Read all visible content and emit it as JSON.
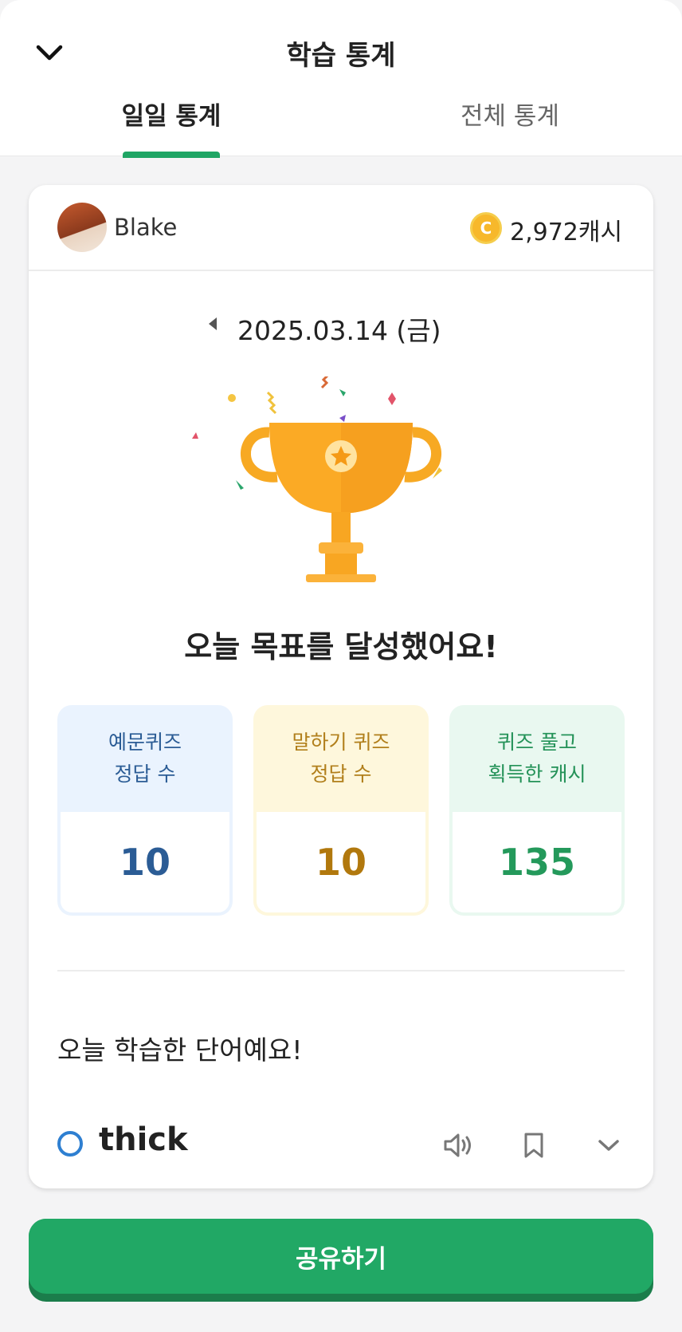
{
  "header": {
    "title": "학습 통계",
    "back_icon": "chevron-down-icon"
  },
  "tabs": [
    {
      "label": "일일 통계",
      "active": true
    },
    {
      "label": "전체 통계",
      "active": false
    }
  ],
  "profile": {
    "name": "Blake",
    "cash": "2,972캐시",
    "coin_symbol": "C"
  },
  "date": {
    "text": "2025.03.14 (금)"
  },
  "goal_message": "오늘 목표를 달성했어요!",
  "stats": [
    {
      "label_line1": "예문퀴즈",
      "label_line2": "정답 수",
      "value": "10",
      "color": "#2b5c95"
    },
    {
      "label_line1": "말하기 퀴즈",
      "label_line2": "정답 수",
      "value": "10",
      "color": "#b1780d"
    },
    {
      "label_line1": "퀴즈 풀고",
      "label_line2": "획득한 캐시",
      "value": "135",
      "color": "#24995b"
    }
  ],
  "learned_title": "오늘 학습한 단어예요!",
  "words": [
    {
      "word": "thick"
    }
  ],
  "share_button": "공유하기",
  "colors": {
    "accent": "#21a865",
    "coin": "#f7b82b"
  }
}
